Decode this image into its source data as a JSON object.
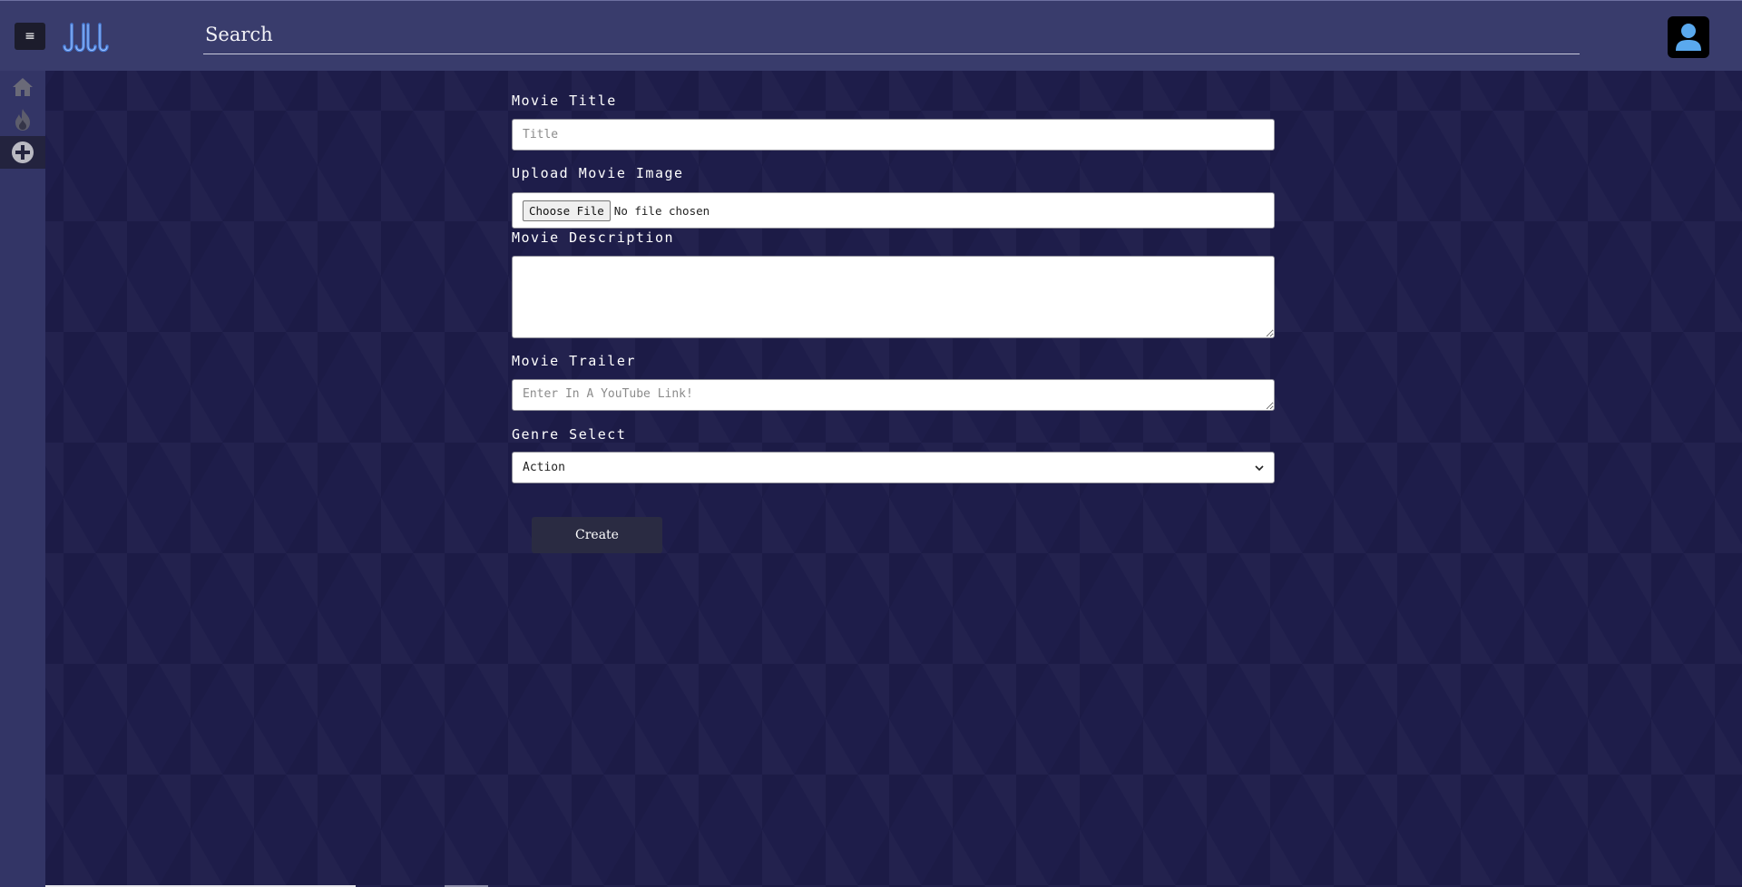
{
  "header": {
    "menu_icon": "≡",
    "logo_icon": "logo-icon",
    "search_placeholder": "Search",
    "avatar_icon": "user-icon"
  },
  "sidebar": {
    "items": [
      {
        "icon": "home-icon",
        "active": false
      },
      {
        "icon": "fire-icon",
        "active": false
      },
      {
        "icon": "plus-circle-icon",
        "active": true
      }
    ]
  },
  "form": {
    "title_label": "Movie Title",
    "title_placeholder": "Title",
    "image_label": "Upload Movie Image",
    "choose_file_label": "Choose File",
    "file_status": "No file chosen",
    "description_label": "Movie Description",
    "description_value": "",
    "trailer_label": "Movie Trailer",
    "trailer_placeholder": "Enter In A YouTube Link!",
    "genre_label": "Genre Select",
    "genre_selected": "Action",
    "create_label": "Create"
  },
  "colors": {
    "background": "#1e1d4a",
    "topbar": "#393c6c",
    "sidebar": "#333566",
    "button": "#2a2b42",
    "logo_accent": "#4a7fd9",
    "avatar_accent": "#5aa9ee"
  }
}
